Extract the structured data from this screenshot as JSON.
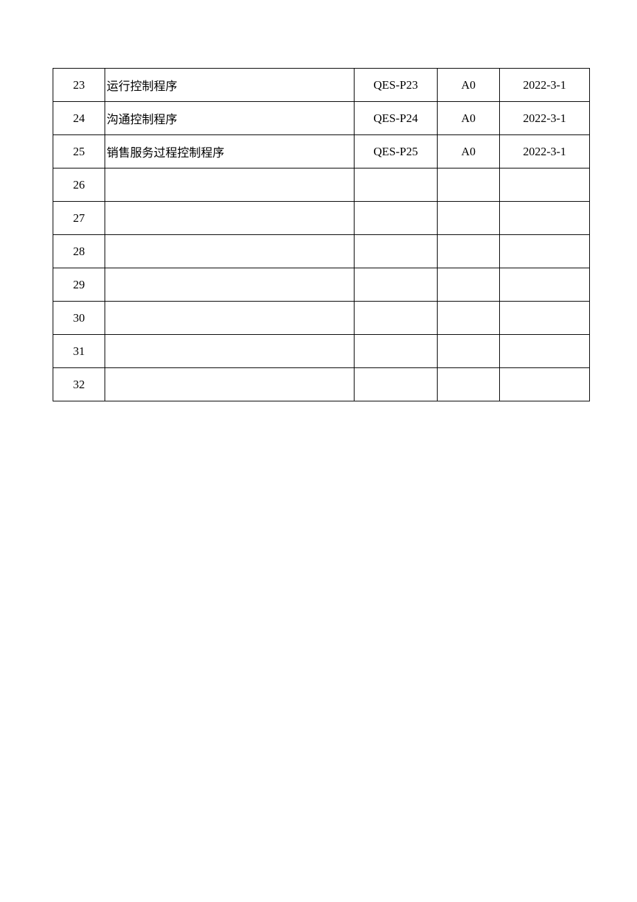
{
  "rows": [
    {
      "num": "23",
      "name": "运行控制程序",
      "code": "QES-P23",
      "ver": "A0",
      "date": "2022-3-1"
    },
    {
      "num": "24",
      "name": "沟通控制程序",
      "code": "QES-P24",
      "ver": "A0",
      "date": "2022-3-1"
    },
    {
      "num": "25",
      "name": "销售服务过程控制程序",
      "code": "QES-P25",
      "ver": "A0",
      "date": "2022-3-1"
    },
    {
      "num": "26",
      "name": "",
      "code": "",
      "ver": "",
      "date": ""
    },
    {
      "num": "27",
      "name": "",
      "code": "",
      "ver": "",
      "date": ""
    },
    {
      "num": "28",
      "name": "",
      "code": "",
      "ver": "",
      "date": ""
    },
    {
      "num": "29",
      "name": "",
      "code": "",
      "ver": "",
      "date": ""
    },
    {
      "num": "30",
      "name": "",
      "code": "",
      "ver": "",
      "date": ""
    },
    {
      "num": "31",
      "name": "",
      "code": "",
      "ver": "",
      "date": ""
    },
    {
      "num": "32",
      "name": "",
      "code": "",
      "ver": "",
      "date": ""
    }
  ]
}
